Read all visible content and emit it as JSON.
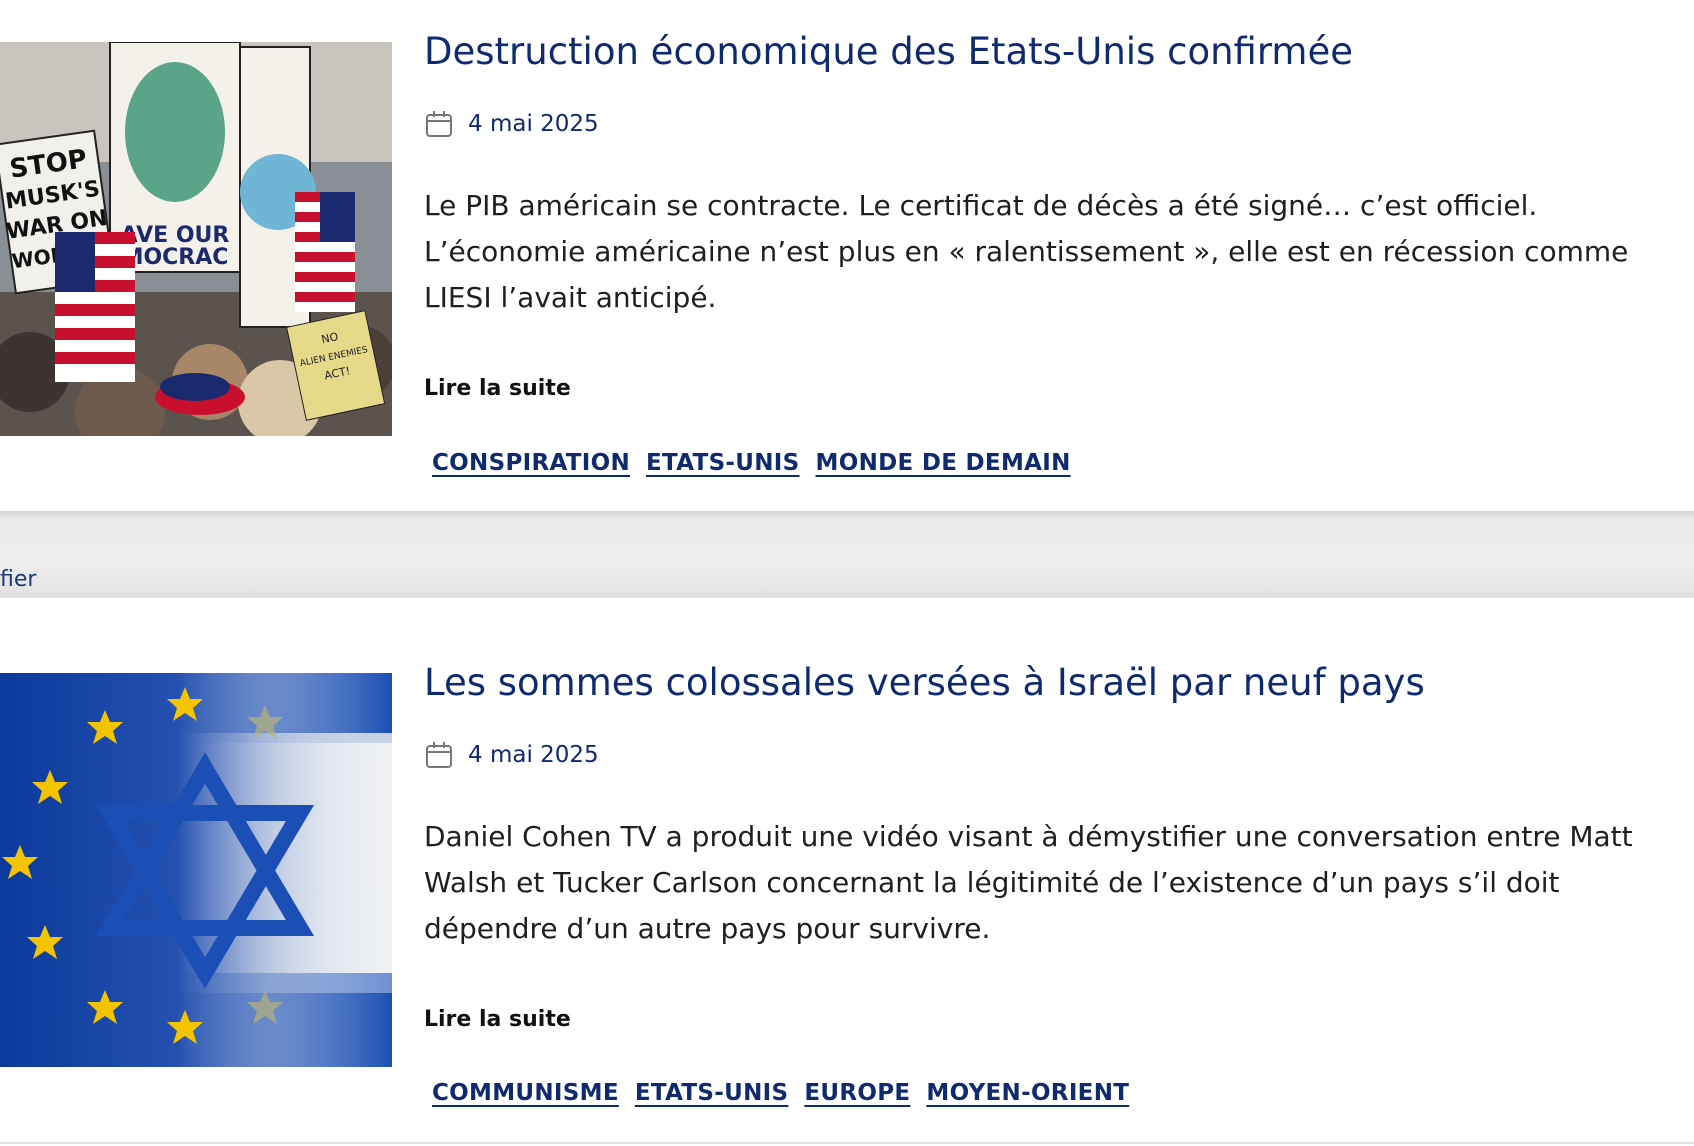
{
  "articles": [
    {
      "title": "Destruction économique des Etats-Unis confirmée",
      "date": "4 mai 2025",
      "excerpt": "Le PIB américain se contracte. Le certificat de décès a été signé… c’est officiel. L’économie américaine n’est plus en « ralentissement », elle est en récession comme LIESI l’avait anticipé.",
      "read_more": "Lire la suite",
      "tags": [
        "CONSPIRATION",
        "ETATS-UNIS",
        "MONDE DE DEMAIN"
      ],
      "image": {
        "signs": [
          "STOP",
          "MUSK'S",
          "WAR ON",
          "WORKER",
          "AVE OUR",
          "MOCRAC",
          "NO",
          "ALIEN ENEMIES",
          "ACT!"
        ]
      }
    },
    {
      "title": "Les sommes colossales versées à Israël par neuf pays",
      "date": "4 mai 2025",
      "excerpt": "Daniel Cohen TV a produit une vidéo visant à démystifier une conversation entre Matt Walsh et Tucker Carlson concernant la légitimité de l’existence d’un pays s’il doit dépendre d’un autre pays pour survivre.",
      "read_more": "Lire la suite",
      "tags": [
        "COMMUNISME",
        "ETATS-UNIS",
        "EUROPE",
        "MOYEN-ORIENT"
      ]
    }
  ],
  "divider": {
    "text": "fier"
  },
  "icons": {
    "date_icon": "calendar-icon"
  },
  "colors": {
    "link_blue": "#0f2a6e",
    "body_text": "#1f1f1f",
    "divider_gray": "#eeeeee"
  }
}
